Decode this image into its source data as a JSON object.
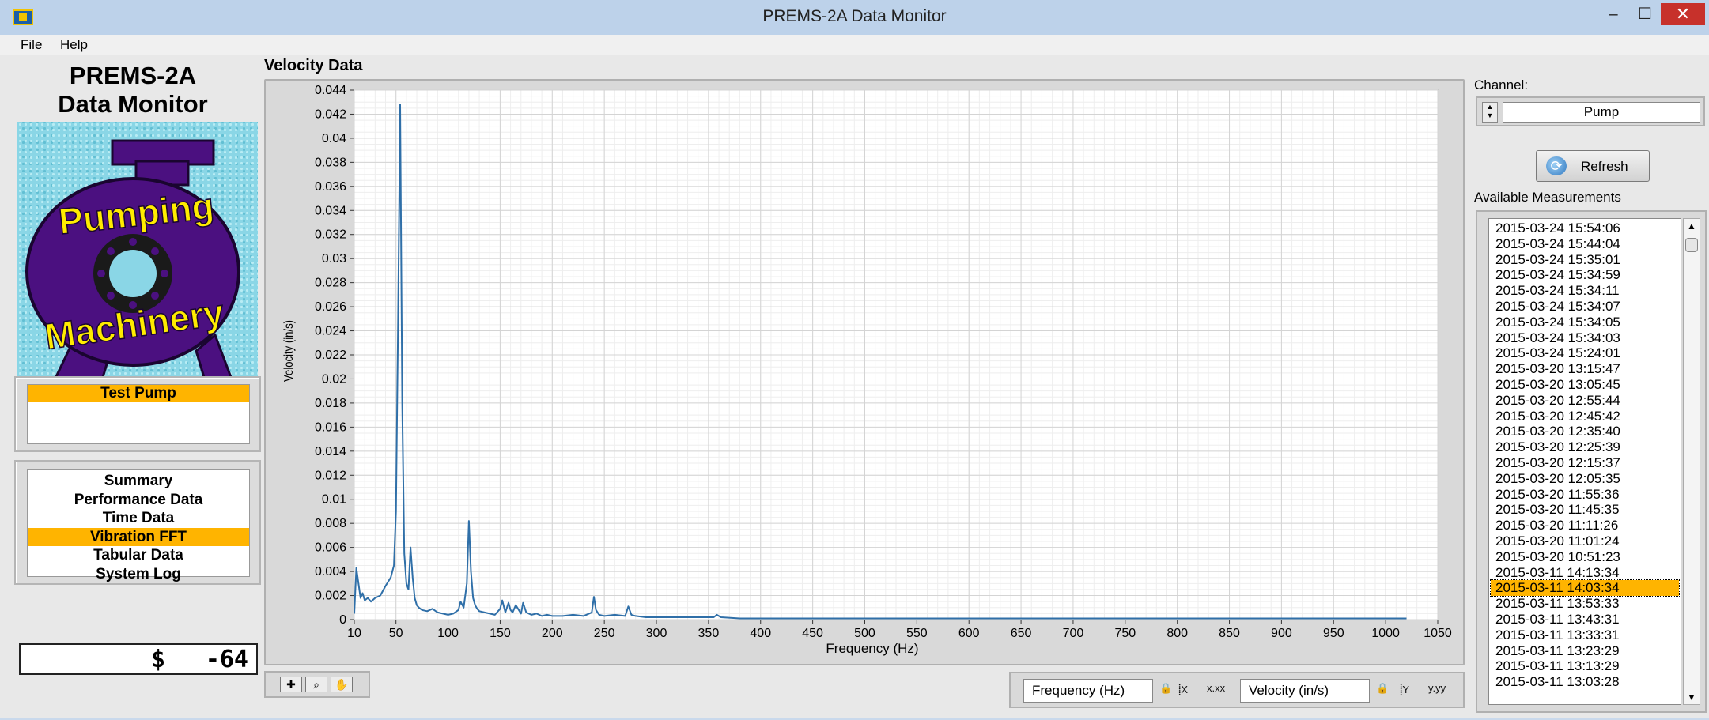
{
  "window": {
    "title": "PREMS-2A Data Monitor",
    "minimize": "–",
    "maximize": "☐",
    "close": "✕"
  },
  "menu": {
    "file": "File",
    "help": "Help"
  },
  "logo": {
    "title_line1": "PREMS-2A",
    "title_line2": "Data Monitor",
    "word1": "Pumping",
    "word2": "Machinery",
    "colors": {
      "background": "#8ad6e6",
      "pump_body": "#4b1080",
      "lettering": "#ffec00"
    }
  },
  "pump": {
    "name": "Test Pump"
  },
  "nav": {
    "items": [
      "Summary",
      "Performance Data",
      "Time Data",
      "Vibration FFT",
      "Tabular Data",
      "System Log"
    ],
    "selected": "Vibration FFT"
  },
  "cost": {
    "symbol": "$",
    "value": "-64"
  },
  "graph": {
    "title": "Velocity Data"
  },
  "chart_data": {
    "type": "line",
    "xlabel": "Frequency (Hz)",
    "ylabel": "Velocity (in/s)",
    "xlim": [
      10,
      1050
    ],
    "ylim": [
      0,
      0.044
    ],
    "x_ticks": [
      10,
      50,
      100,
      150,
      200,
      250,
      300,
      350,
      400,
      450,
      500,
      550,
      600,
      650,
      700,
      750,
      800,
      850,
      900,
      950,
      1000,
      1050
    ],
    "y_ticks": [
      0,
      0.002,
      0.004,
      0.006,
      0.008,
      0.01,
      0.012,
      0.014,
      0.016,
      0.018,
      0.02,
      0.022,
      0.024,
      0.026,
      0.028,
      0.03,
      0.032,
      0.034,
      0.036,
      0.038,
      0.04,
      0.042,
      0.044
    ],
    "y_tick_labels": [
      "0",
      "0.002",
      "0.004",
      "0.006",
      "0.008",
      "0.01",
      "0.012",
      "0.014",
      "0.016",
      "0.018",
      "0.02",
      "0.022",
      "0.024",
      "0.026",
      "0.028",
      "0.03",
      "0.032",
      "0.034",
      "0.036",
      "0.038",
      "0.04",
      "0.042",
      "0.044"
    ],
    "grid": true,
    "line_color": "#2f6fa8",
    "x": [
      10,
      12,
      14,
      16,
      18,
      20,
      23,
      26,
      30,
      35,
      40,
      45,
      48,
      50,
      52,
      54,
      56,
      58,
      60,
      62,
      64,
      66,
      68,
      70,
      72,
      75,
      80,
      85,
      90,
      95,
      100,
      105,
      110,
      112,
      115,
      118,
      120,
      122,
      124,
      126,
      128,
      130,
      135,
      140,
      145,
      150,
      152,
      155,
      158,
      160,
      162,
      165,
      170,
      172,
      175,
      180,
      185,
      190,
      195,
      200,
      210,
      220,
      230,
      238,
      240,
      242,
      245,
      250,
      260,
      270,
      273,
      276,
      280,
      290,
      300,
      320,
      340,
      355,
      358,
      362,
      380,
      400,
      450,
      500,
      550,
      600,
      650,
      700,
      750,
      800,
      850,
      900,
      950,
      1000,
      1020
    ],
    "y": [
      0.0005,
      0.0043,
      0.003,
      0.0018,
      0.0022,
      0.0016,
      0.0018,
      0.0015,
      0.0018,
      0.002,
      0.0028,
      0.0035,
      0.0045,
      0.009,
      0.0245,
      0.0428,
      0.018,
      0.0055,
      0.003,
      0.0025,
      0.006,
      0.0035,
      0.0018,
      0.0012,
      0.001,
      0.0008,
      0.0007,
      0.0009,
      0.0006,
      0.0005,
      0.0004,
      0.0005,
      0.0008,
      0.0015,
      0.001,
      0.003,
      0.0082,
      0.004,
      0.0018,
      0.0012,
      0.0009,
      0.0007,
      0.0006,
      0.0005,
      0.0004,
      0.0009,
      0.0016,
      0.0006,
      0.0014,
      0.0008,
      0.0006,
      0.0012,
      0.0005,
      0.0014,
      0.0006,
      0.0004,
      0.0005,
      0.0003,
      0.0004,
      0.0003,
      0.0003,
      0.0004,
      0.0003,
      0.0006,
      0.0019,
      0.0008,
      0.0004,
      0.0003,
      0.0004,
      0.0003,
      0.0011,
      0.0004,
      0.0003,
      0.0002,
      0.0002,
      0.0002,
      0.0002,
      0.0002,
      0.0004,
      0.0002,
      0.0001,
      0.0001,
      0.0001,
      0.0001,
      0.0001,
      0.0001,
      0.0001,
      0.0001,
      0.0001,
      0.0001,
      0.0001,
      0.0001,
      0.0001,
      0.0001,
      0.0001
    ]
  },
  "palette": {
    "crosshair": "✚",
    "zoom": "⌕",
    "pan": "✋"
  },
  "axis_panel": {
    "x_name": "Frequency (Hz)",
    "y_name": "Velocity (in/s)",
    "lock_icon": "🔒",
    "x_autoscale_label": "⸽X",
    "x_format_label": "x.xx",
    "y_autoscale_label": "⸽Y",
    "y_format_label": "y.yy"
  },
  "channel": {
    "label": "Channel:",
    "value": "Pump"
  },
  "refresh": {
    "label": "Refresh"
  },
  "measurements": {
    "label": "Available Measurements",
    "items": [
      "2015-03-24 15:54:06",
      "2015-03-24 15:44:04",
      "2015-03-24 15:35:01",
      "2015-03-24 15:34:59",
      "2015-03-24 15:34:11",
      "2015-03-24 15:34:07",
      "2015-03-24 15:34:05",
      "2015-03-24 15:34:03",
      "2015-03-24 15:24:01",
      "2015-03-20 13:15:47",
      "2015-03-20 13:05:45",
      "2015-03-20 12:55:44",
      "2015-03-20 12:45:42",
      "2015-03-20 12:35:40",
      "2015-03-20 12:25:39",
      "2015-03-20 12:15:37",
      "2015-03-20 12:05:35",
      "2015-03-20 11:55:36",
      "2015-03-20 11:45:35",
      "2015-03-20 11:11:26",
      "2015-03-20 11:01:24",
      "2015-03-20 10:51:23",
      "2015-03-11 14:13:34",
      "2015-03-11 14:03:34",
      "2015-03-11 13:53:33",
      "2015-03-11 13:43:31",
      "2015-03-11 13:33:31",
      "2015-03-11 13:23:29",
      "2015-03-11 13:13:29",
      "2015-03-11 13:03:28"
    ],
    "selected": "2015-03-11 14:03:34"
  }
}
